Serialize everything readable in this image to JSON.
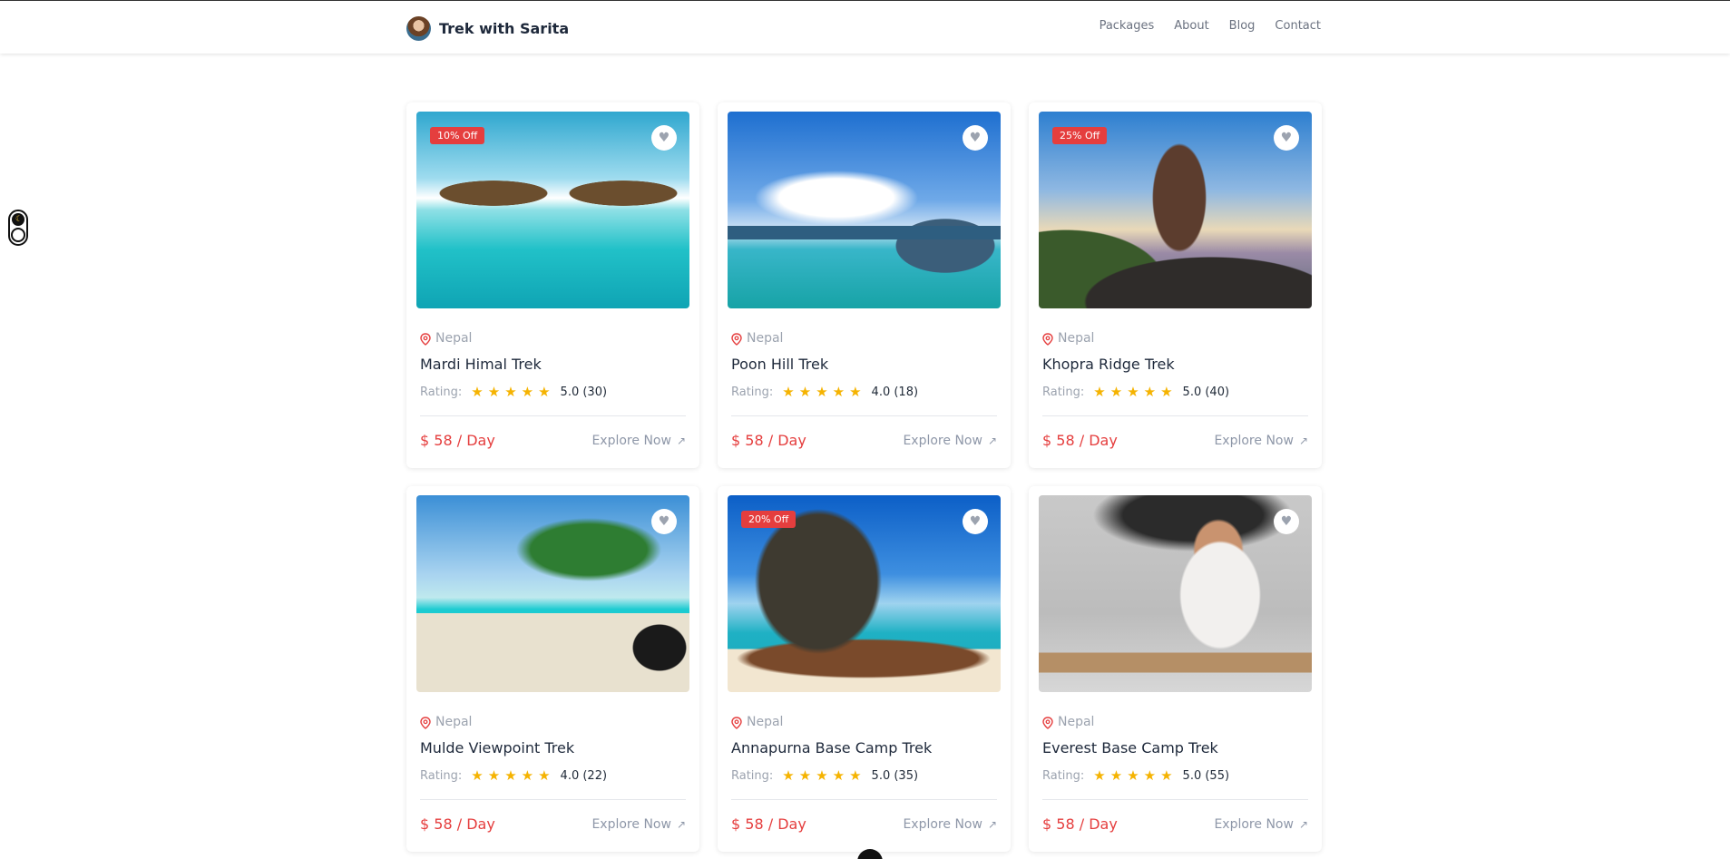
{
  "header": {
    "brand": "Trek with Sarita",
    "nav": [
      "Packages",
      "About",
      "Blog",
      "Contact"
    ]
  },
  "icons": {
    "heart": "♥",
    "arrow": "↗",
    "stars": "★★★★★",
    "moon": "☾"
  },
  "colors": {
    "accent": "#e53e3e",
    "star": "#f5b301",
    "muted": "#9ca3af"
  },
  "labels": {
    "rating": "Rating:",
    "explore": "Explore Now"
  },
  "packages": [
    {
      "badge": "10% Off",
      "location": "Nepal",
      "title": "Mardi Himal Trek",
      "rating": "5.0 (30)",
      "price": "$ 58 / Day"
    },
    {
      "badge": "",
      "location": "Nepal",
      "title": "Poon Hill Trek",
      "rating": "4.0 (18)",
      "price": "$ 58 / Day"
    },
    {
      "badge": "25% Off",
      "location": "Nepal",
      "title": "Khopra Ridge Trek",
      "rating": "5.0 (40)",
      "price": "$ 58 / Day"
    },
    {
      "badge": "",
      "location": "Nepal",
      "title": "Mulde Viewpoint Trek",
      "rating": "4.0 (22)",
      "price": "$ 58 / Day"
    },
    {
      "badge": "20% Off",
      "location": "Nepal",
      "title": "Annapurna Base Camp Trek",
      "rating": "5.0 (35)",
      "price": "$ 58 / Day"
    },
    {
      "badge": "",
      "location": "Nepal",
      "title": "Everest Base Camp Trek",
      "rating": "5.0 (55)",
      "price": "$ 58 / Day"
    }
  ]
}
